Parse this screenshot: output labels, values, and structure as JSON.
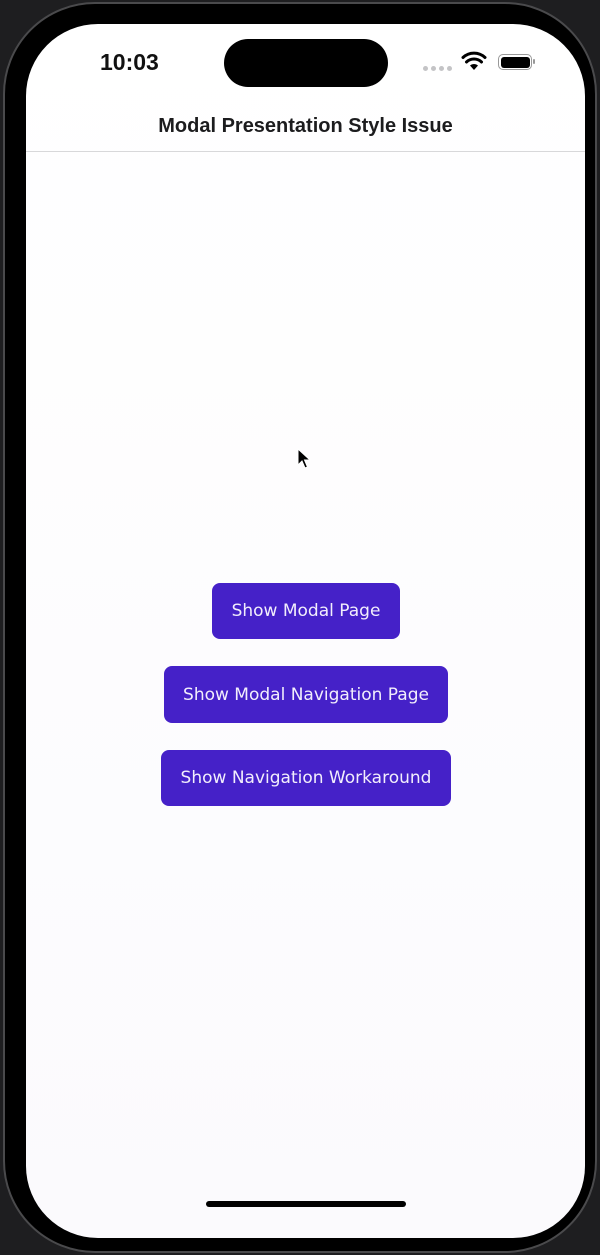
{
  "status_bar": {
    "time": "10:03",
    "icons": [
      "cellular-icon",
      "wifi-icon",
      "battery-icon"
    ]
  },
  "header": {
    "title": "Modal Presentation Style Issue"
  },
  "main": {
    "buttons": [
      {
        "label": "Show Modal Page"
      },
      {
        "label": "Show Modal Navigation Page"
      },
      {
        "label": "Show Navigation Workaround"
      }
    ]
  },
  "colors": {
    "accent": "#4521c8",
    "button_text": "#f2eefc"
  }
}
